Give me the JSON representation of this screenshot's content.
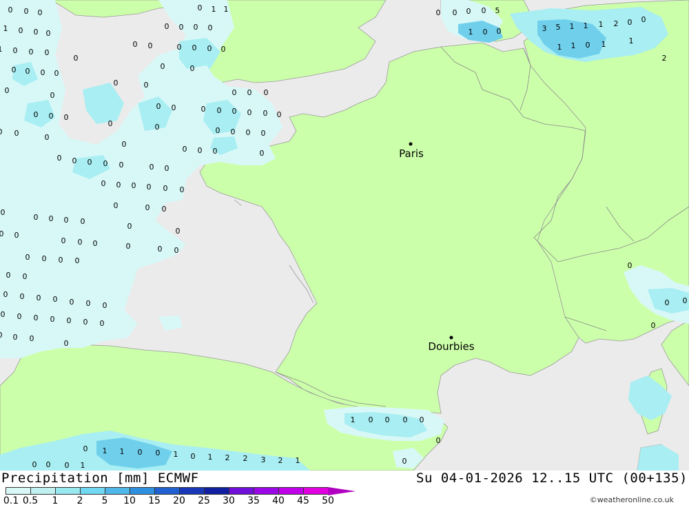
{
  "title": {
    "left": "Precipitation [mm] ECMWF",
    "right": "Su 04-01-2026 12..15 UTC (00+135)"
  },
  "credit": "©weatheronline.co.uk",
  "legend": {
    "ticks": [
      "0.1",
      "0.5",
      "1",
      "2",
      "5",
      "10",
      "15",
      "20",
      "25",
      "30",
      "35",
      "40",
      "45",
      "50"
    ],
    "colors": [
      "#d8f8f8",
      "#c0f0f0",
      "#98e8f0",
      "#70d8f0",
      "#50b8e8",
      "#3090e0",
      "#2060d0",
      "#1838b8",
      "#1020a0",
      "#7010d8",
      "#9a08e8",
      "#c000e8",
      "#e000e0",
      "#b000c0"
    ]
  },
  "cities": [
    {
      "name": "Paris"
    },
    {
      "name": "Dourbies"
    }
  ],
  "precip_labels": [
    "0",
    "0",
    "0",
    "0",
    "1",
    "1",
    "1",
    "0",
    "0",
    "0",
    "1",
    "0",
    "0",
    "0",
    "0",
    "0",
    "0",
    "0",
    "0",
    "0",
    "0",
    "0",
    "0",
    "0",
    "0",
    "0",
    "0",
    "0",
    "0",
    "0",
    "0",
    "0",
    "0",
    "0",
    "0",
    "0",
    "0",
    "0",
    "0",
    "0",
    "0",
    "0",
    "0",
    "0",
    "0",
    "0",
    "0",
    "0",
    "0",
    "0",
    "0",
    "0",
    "0",
    "0",
    "0",
    "0",
    "0",
    "0",
    "0",
    "0",
    "0",
    "0",
    "0",
    "0",
    "0",
    "0",
    "0",
    "0",
    "0",
    "0",
    "0",
    "0",
    "0",
    "0",
    "0",
    "0",
    "0",
    "0",
    "0",
    "0",
    "0",
    "0",
    "0",
    "0",
    "0",
    "0",
    "0",
    "0",
    "0",
    "0",
    "0",
    "0",
    "0",
    "0",
    "0",
    "0",
    "0",
    "0",
    "0",
    "0",
    "0",
    "0",
    "0",
    "0",
    "0",
    "0",
    "0",
    "0",
    "0",
    "0",
    "0",
    "0",
    "0",
    "0",
    "0",
    "0",
    "0",
    "0",
    "0",
    "0",
    "0",
    "0",
    "0",
    "0",
    "0",
    "0",
    "5",
    "1",
    "0",
    "0",
    "3",
    "5",
    "1",
    "1",
    "1",
    "2",
    "0",
    "0",
    "1",
    "1",
    "0",
    "1",
    "1",
    "2",
    "1",
    "0",
    "0",
    "0",
    "0",
    "0",
    "0",
    "1",
    "1",
    "0",
    "0",
    "1",
    "0",
    "1",
    "2",
    "2",
    "3",
    "2",
    "1",
    "0",
    "0",
    "0",
    "0",
    "1",
    "0",
    "0",
    "1",
    "2",
    "3",
    "1",
    "0"
  ],
  "colors": {
    "land": "#ccff aa",
    "sea": "#ebebeb",
    "precip_light": "#d8f8f8",
    "precip_mid": "#a8eef2",
    "precip_heavy": "#70d0ec"
  }
}
